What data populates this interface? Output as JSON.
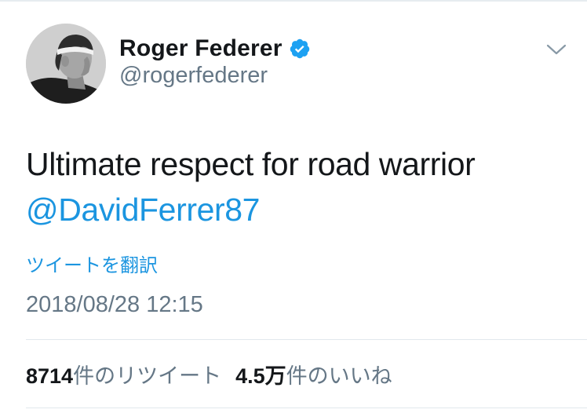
{
  "tweet": {
    "display_name": "Roger Federer",
    "handle": "@rogerfederer",
    "text": "Ultimate respect for road warrior",
    "mention": "@DavidFerrer87",
    "translate_label": "ツイートを翻訳",
    "timestamp": "2018/08/28 12:15",
    "retweet_count": "8714",
    "retweet_label": "件のリツイート",
    "like_count": "4.5万",
    "like_label": "件のいいね"
  },
  "icons": {
    "verified": "verified-badge-icon",
    "menu": "chevron-down-icon",
    "avatar": "profile-photo"
  },
  "colors": {
    "link": "#1b95e0",
    "text": "#14171a",
    "secondary": "#657786",
    "verified": "#1da1f2"
  }
}
